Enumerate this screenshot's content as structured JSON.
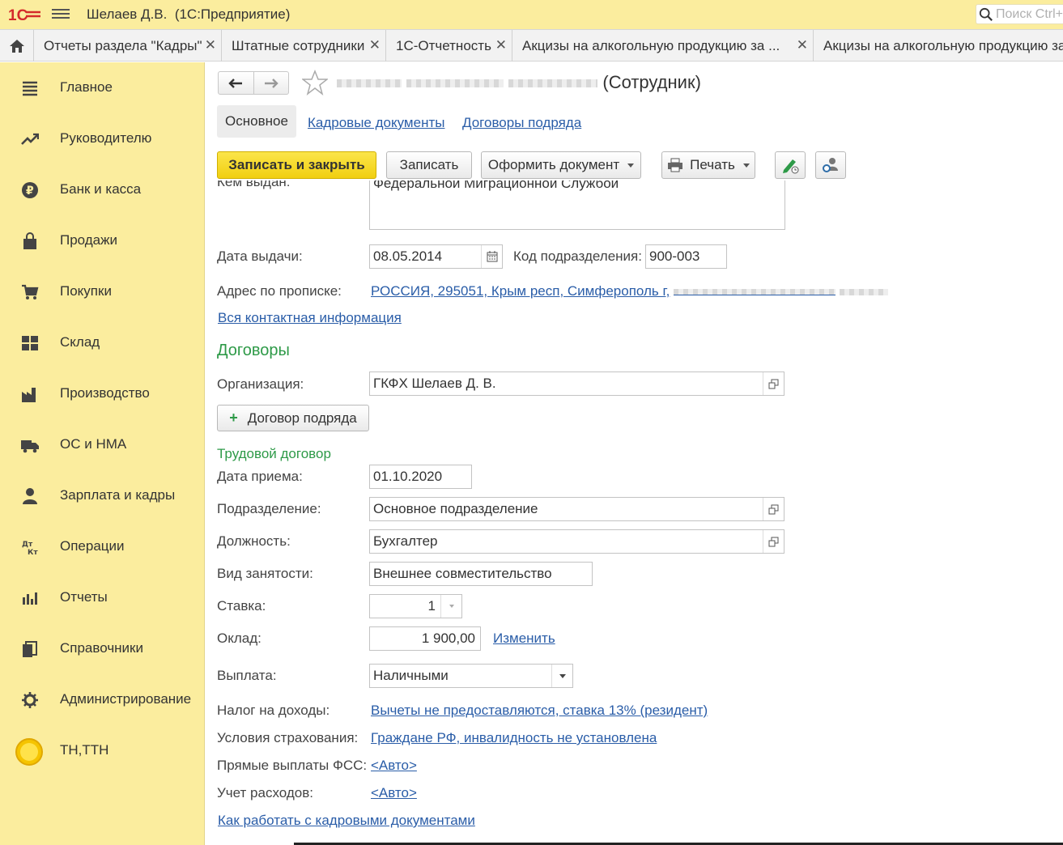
{
  "app": {
    "user": "Шелаев Д.В.",
    "product": "(1С:Предприятие)",
    "search_placeholder": "Поиск Ctrl+"
  },
  "tabs": [
    {
      "label": "Отчеты раздела \"Кадры\""
    },
    {
      "label": "Штатные сотрудники"
    },
    {
      "label": "1С-Отчетность"
    },
    {
      "label": "Акцизы на алкогольную продукцию за ..."
    },
    {
      "label": "Акцизы на алкогольную продукцию за"
    }
  ],
  "sidebar": {
    "items": [
      {
        "label": "Главное",
        "icon": "list-icon"
      },
      {
        "label": "Руководителю",
        "icon": "trend-icon"
      },
      {
        "label": "Банк и касса",
        "icon": "ruble-icon"
      },
      {
        "label": "Продажи",
        "icon": "bag-icon"
      },
      {
        "label": "Покупки",
        "icon": "cart-icon"
      },
      {
        "label": "Склад",
        "icon": "warehouse-icon"
      },
      {
        "label": "Производство",
        "icon": "factory-icon"
      },
      {
        "label": "ОС и НМА",
        "icon": "truck-icon"
      },
      {
        "label": "Зарплата и кадры",
        "icon": "person-icon"
      },
      {
        "label": "Операции",
        "icon": "dt-kt-icon"
      },
      {
        "label": "Отчеты",
        "icon": "bar-chart-icon"
      },
      {
        "label": "Справочники",
        "icon": "books-icon"
      },
      {
        "label": "Администрирование",
        "icon": "gear-icon"
      },
      {
        "label": "ТН,ТТН",
        "icon": "circle-icon"
      }
    ]
  },
  "form": {
    "title_suffix": "(Сотрудник)",
    "subtabs": {
      "main": "Основное",
      "hr_docs": "Кадровые документы",
      "contracts": "Договоры подряда"
    },
    "toolbar": {
      "save_close": "Записать и закрыть",
      "save": "Записать",
      "make_doc": "Оформить документ",
      "print": "Печать"
    },
    "passport": {
      "issued_by_label": "Кем выдан:",
      "issued_by_value": "Федеральной Миграционной Службой",
      "issue_date_label": "Дата выдачи:",
      "issue_date_value": "08.05.2014",
      "dept_code_label": "Код подразделения:",
      "dept_code_value": "900-003"
    },
    "address_label": "Адрес по прописке:",
    "address_value": "РОССИЯ, 295051, Крым респ, Симферополь г,",
    "all_contacts_link": "Вся контактная информация",
    "contracts_section": "Договоры",
    "org_label": "Организация:",
    "org_value": "ГКФХ Шелаев Д. В.",
    "gph_button": "Договор подряда",
    "labor_section": "Трудовой договор",
    "hire_date_label": "Дата приема:",
    "hire_date_value": "01.10.2020",
    "division_label": "Подразделение:",
    "division_value": "Основное подразделение",
    "position_label": "Должность:",
    "position_value": "Бухгалтер",
    "employment_label": "Вид занятости:",
    "employment_value": "Внешнее совместительство",
    "rate_label": "Ставка:",
    "rate_value": "1",
    "salary_label": "Оклад:",
    "salary_value": "1 900,00",
    "salary_change": "Изменить",
    "payment_label": "Выплата:",
    "payment_value": "Наличными",
    "tax_label": "Налог на доходы:",
    "tax_value": "Вычеты не предоставляются, ставка 13% (резидент)",
    "insurance_label": "Условия страхования:",
    "insurance_value": "Граждане РФ, инвалидность не установлена",
    "fss_label": "Прямые выплаты ФСС:",
    "fss_value": "<Авто>",
    "expense_label": "Учет расходов:",
    "expense_value": "<Авто>",
    "help_link": "Как работать с кадровыми документами"
  }
}
